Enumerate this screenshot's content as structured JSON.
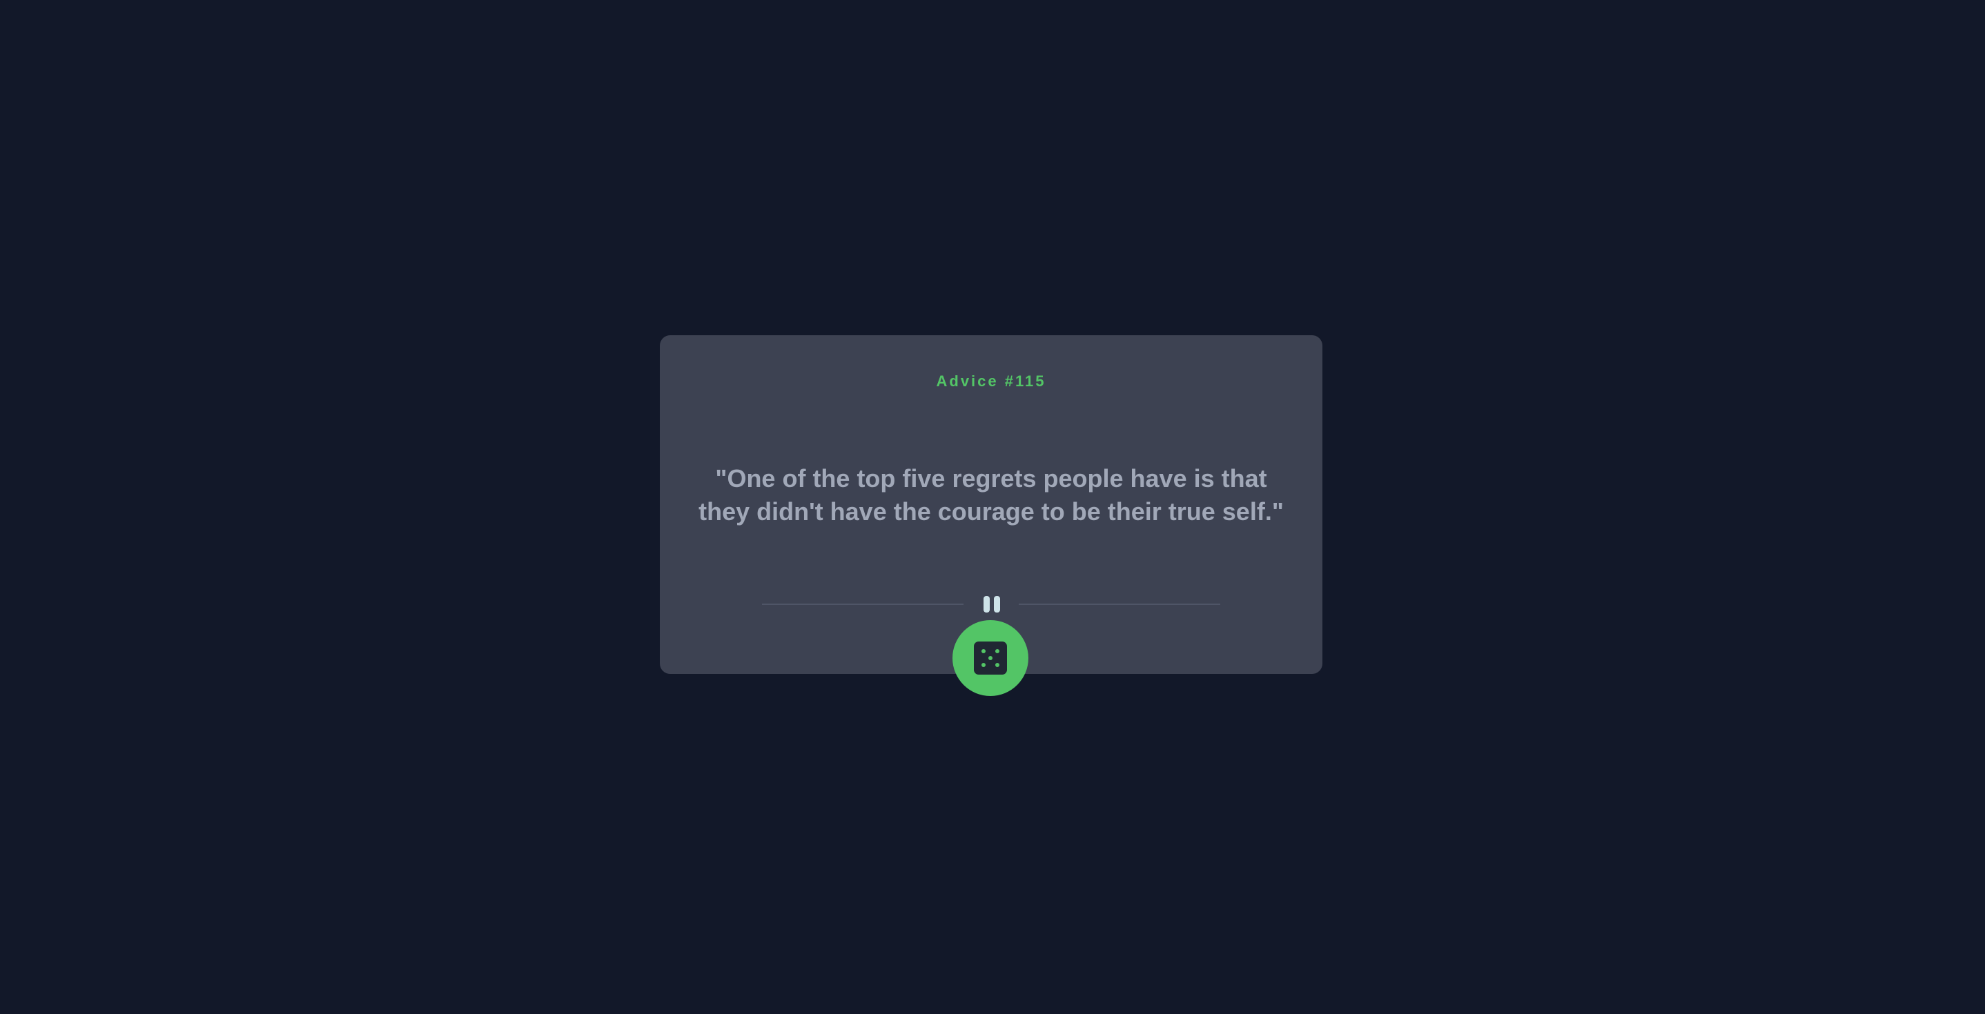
{
  "advice": {
    "id_label": "Advice #115",
    "quote": "\"One of the top five regrets people have is that they didn't have the courage to be their true self.\""
  },
  "divider": {
    "icon": "pause-icon"
  },
  "dice_button": {
    "icon": "dice-icon"
  },
  "colors": {
    "background": "#121829",
    "card": "#3d4252",
    "accent": "#53c566",
    "quote_text": "#a1a8b8",
    "divider_line": "#4f5567",
    "divider_icon": "#cee3e9"
  }
}
